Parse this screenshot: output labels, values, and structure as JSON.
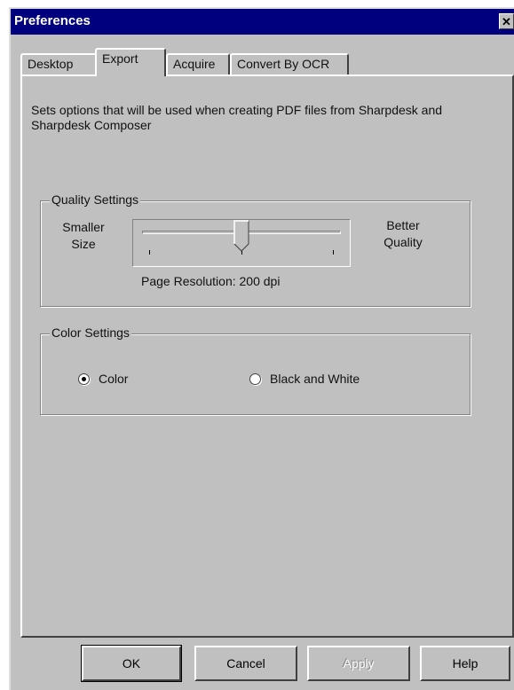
{
  "window": {
    "title": "Preferences",
    "close_glyph": "✕"
  },
  "tabs": [
    {
      "label": "Desktop",
      "active": false
    },
    {
      "label": "Export",
      "active": true
    },
    {
      "label": "Acquire",
      "active": false
    },
    {
      "label": "Convert By OCR",
      "active": false
    }
  ],
  "description": "Sets options that will be used when creating PDF files from Sharpdesk and Sharpdesk Composer",
  "quality": {
    "group_label": "Quality Settings",
    "left_label_line1": "Smaller",
    "left_label_line2": "Size",
    "right_label_line1": "Better",
    "right_label_line2": "Quality",
    "resolution_text": "Page Resolution: 200 dpi",
    "slider_level_fraction": 0.5
  },
  "color": {
    "group_label": "Color Settings",
    "options": [
      {
        "label": "Color",
        "selected": true
      },
      {
        "label": "Black and White",
        "selected": false
      }
    ]
  },
  "buttons": {
    "ok": "OK",
    "cancel": "Cancel",
    "apply": "Apply",
    "help": "Help"
  },
  "colors": {
    "face": "#c0c0c0",
    "titlebar": "#00007f",
    "highlight": "#ffffff",
    "shadow": "#808080"
  }
}
